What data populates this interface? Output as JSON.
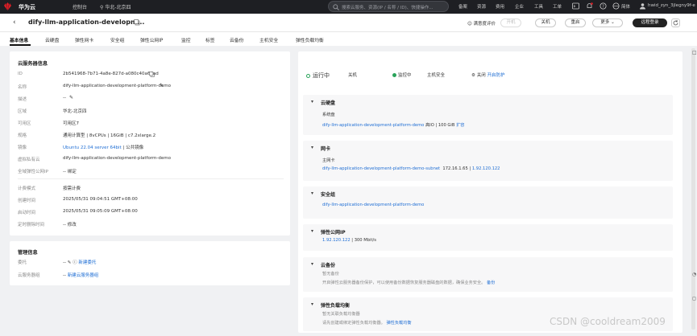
{
  "topbar": {
    "brand": "华为云",
    "console": "控制台",
    "region": "华北-北京四",
    "search_placeholder": "搜索云服务、资源(IP / 名称 / ID)、快捷操作...",
    "nav": [
      "备案",
      "资源",
      "费用",
      "企业",
      "工具",
      "工单"
    ],
    "lang": "简体",
    "user": "hwid_zyn_3jlegny9f-e"
  },
  "header": {
    "title": "dify-llm-application-developm...",
    "feedback": "满意度评价",
    "buttons": {
      "start": "开机",
      "stop": "关机",
      "restart": "重启",
      "more": "更多",
      "remote": "远程登录"
    }
  },
  "tabs": [
    "基本信息",
    "云硬盘",
    "弹性网卡",
    "安全组",
    "弹性公网IP",
    "监控",
    "标签",
    "云备份",
    "主机安全",
    "弹性负载均衡"
  ],
  "server_info": {
    "title": "云服务器信息",
    "rows": [
      {
        "label": "ID",
        "value": "2b541968-7b71-4a8e-827d-a080c40a66ad"
      },
      {
        "label": "名称",
        "value": "dify-llm-application-development-platform-demo"
      },
      {
        "label": "描述",
        "value": "--"
      },
      {
        "label": "区域",
        "value": "华北-北京四"
      },
      {
        "label": "可用区",
        "value": "可用区7"
      },
      {
        "label": "规格",
        "value": "通用计算型 | 8vCPUs | 16GiB | c7.2xlarge.2"
      },
      {
        "label": "镜像",
        "value": "Ubuntu 22.04 server 64bit",
        "value2": " | 公共镜像"
      },
      {
        "label": "虚拟私有云",
        "value": "dify-llm-application-development-platform-demo"
      },
      {
        "label": "全域弹性公网IP",
        "value": "-- 绑定"
      }
    ],
    "rows2": [
      {
        "label": "计费模式",
        "value": "按需计费"
      },
      {
        "label": "创建时间",
        "value": "2025/05/31 09:04:51 GMT+08:00"
      },
      {
        "label": "启动时间",
        "value": "2025/05/31 09:05:09 GMT+08:00"
      },
      {
        "label": "定时删除时间",
        "value": "-- 修改"
      }
    ]
  },
  "mgmt": {
    "title": "管理信息",
    "rows": [
      {
        "label": "委托",
        "value": "--",
        "link": "新建委托"
      },
      {
        "label": "云服务器组",
        "value": "--",
        "link": "新建云服务器组"
      }
    ]
  },
  "status": {
    "running": "运行中",
    "stop": "关机",
    "monitor": "监控中",
    "host_sec": "主机安全",
    "guard_prefix": "关闭",
    "guard_link": "开启防护"
  },
  "sections": {
    "disk": {
      "title": "云硬盘",
      "sub": "系统盘",
      "link": "dify-llm-application-development-platform-demo",
      "info": " 高IO | 100 GiB ",
      "action": "扩容"
    },
    "nic": {
      "title": "网卡",
      "sub": "主网卡",
      "link": "dify-llm-application-development-platform-demo-subnet",
      "ip1": "172.16.1.65",
      "ip2": "1.92.120.122"
    },
    "sg": {
      "title": "安全组",
      "link": "dify-llm-application-development-platform-demo"
    },
    "eip": {
      "title": "弹性公网IP",
      "ip": "1.92.120.122",
      "bw": "300 Mbit/s"
    },
    "backup": {
      "title": "云备份",
      "note": "暂无备份",
      "desc": "开启弹性云服务器备份保护，可以使用备份数据恢复服务器磁盘的数据，确保业务安全。",
      "link": "备份"
    },
    "elb": {
      "title": "弹性负载均衡",
      "note": "暂无关联负载均衡器",
      "desc": "请先创建或绑定弹性负载均衡器。",
      "link": "弹性负载均衡"
    }
  },
  "watermark": "CSDN @cooldream2009",
  "colors": {
    "accent": "#1f6ed4",
    "running": "#2aa35a",
    "topbar": "#1e1f23"
  }
}
